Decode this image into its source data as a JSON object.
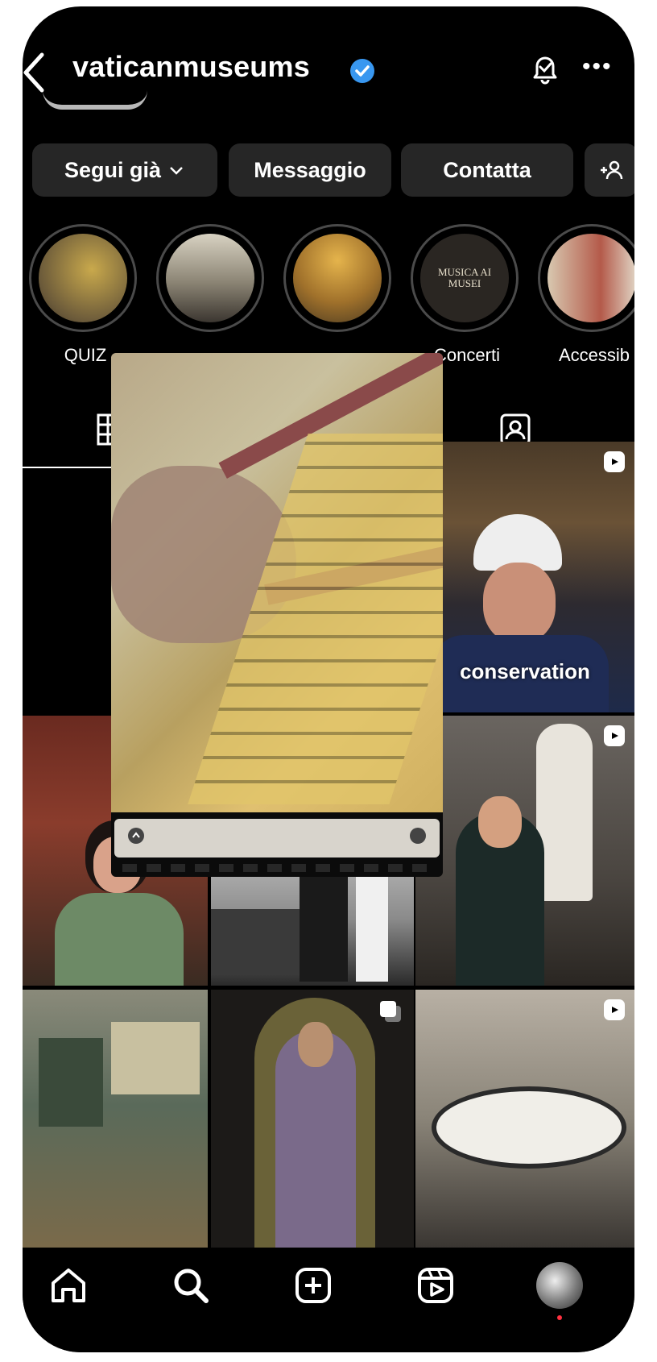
{
  "profile": {
    "username": "vaticanmuseums"
  },
  "buttons": {
    "follow": "Segui già",
    "message": "Messaggio",
    "contact": "Contatta"
  },
  "stories": [
    {
      "label": "QUIZ"
    },
    {
      "label": ""
    },
    {
      "label": ""
    },
    {
      "label": "Concerti",
      "cover_text": "MUSICA AI MUSEI"
    },
    {
      "label": "Accessib"
    }
  ],
  "grid": {
    "caption_conservation": "conservation"
  },
  "icons": {
    "back": "chevron-left-icon",
    "verified": "verified-badge-icon",
    "bell": "bell-icon",
    "more": "more-icon",
    "add_person": "add-person-icon",
    "grid_tab": "grid-icon",
    "tagged_tab": "tagged-icon",
    "reel": "reel-icon",
    "home": "home-icon",
    "search": "search-icon",
    "create": "create-icon",
    "reels": "reels-icon",
    "profile": "avatar"
  },
  "colors": {
    "background": "#000000",
    "button": "#262626",
    "verified": "#3897f0"
  }
}
